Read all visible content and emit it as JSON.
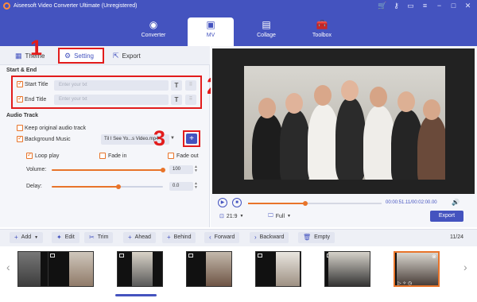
{
  "app": {
    "title": "Aiseesoft Video Converter Ultimate (Unregistered)"
  },
  "nav": {
    "tabs": [
      {
        "label": "Converter",
        "icon": "converter-icon"
      },
      {
        "label": "MV",
        "icon": "mv-icon"
      },
      {
        "label": "Collage",
        "icon": "collage-icon"
      },
      {
        "label": "Toolbox",
        "icon": "toolbox-icon"
      }
    ],
    "active": "MV"
  },
  "subtabs": {
    "theme": "Theme",
    "setting": "Setting",
    "export": "Export"
  },
  "annotations": {
    "one": "1",
    "two": "2",
    "three": "3"
  },
  "start_end": {
    "title": "Start & End",
    "start_label": "Start Title",
    "start_placeholder": "Enter your txt",
    "end_label": "End Title",
    "end_placeholder": "Enter your txt",
    "start_checked": true,
    "end_checked": true
  },
  "audio": {
    "title": "Audio Track",
    "keep_original": "Keep original audio track",
    "background_music": "Background Music",
    "music_value": "Til I See Yo...s Video.mp4",
    "loop_play": "Loop play",
    "fade_in": "Fade in",
    "fade_out": "Fade out",
    "volume_label": "Volume:",
    "volume_value": "100",
    "volume_level_percent": 100,
    "delay_label": "Delay:",
    "delay_value": "0.0",
    "delay_level_percent": 60
  },
  "player": {
    "time": "00:00:51.11/00:02:00.00",
    "progress_percent": 43,
    "ratio": "21:9",
    "mode": "Full",
    "export_label": "Export"
  },
  "toolbar": {
    "add": "Add",
    "edit": "Edit",
    "trim": "Trim",
    "ahead": "Ahead",
    "behind": "Behind",
    "forward": "Forward",
    "backward": "Backward",
    "empty": "Empty",
    "page": "11/24"
  },
  "colors": {
    "brand": "#4453bf",
    "accent": "#e8742a",
    "annotation": "#e21c1c"
  }
}
